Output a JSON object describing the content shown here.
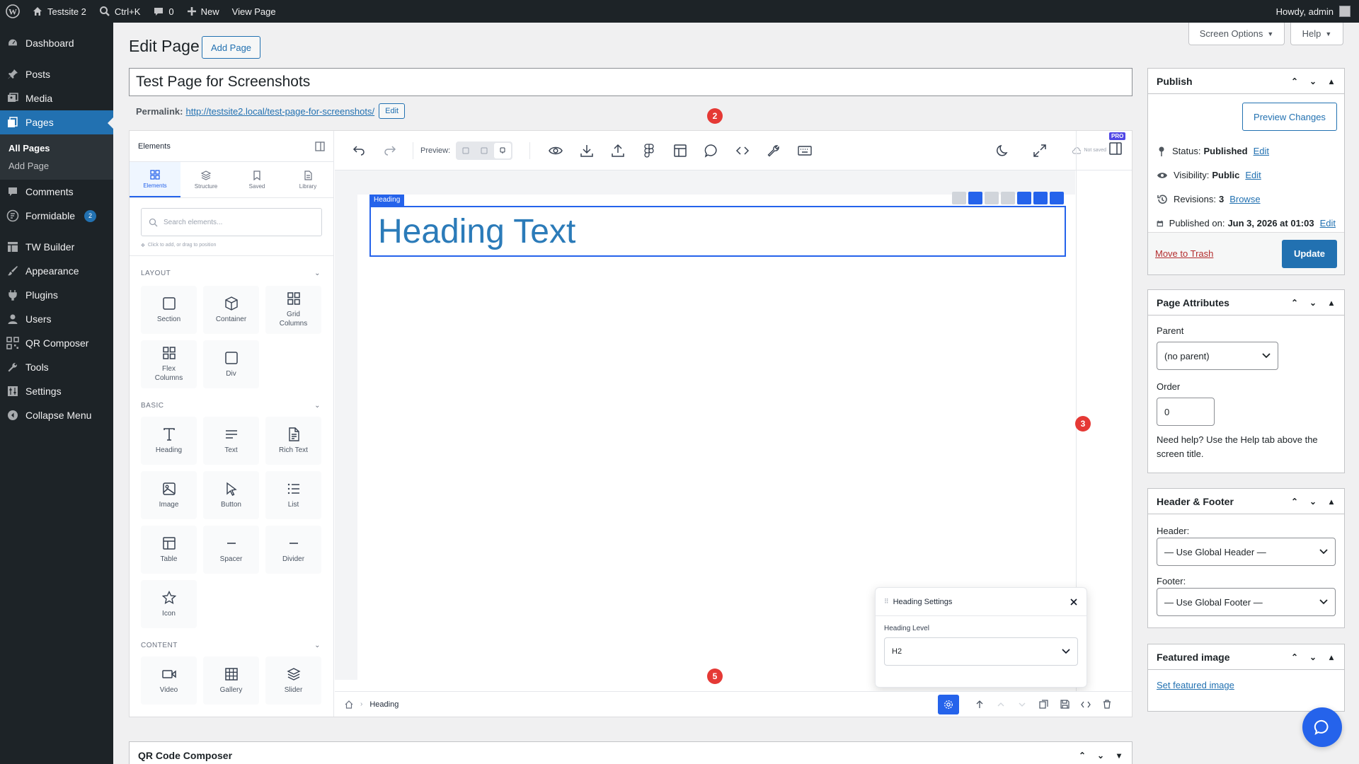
{
  "adminbar": {
    "site_name": "Testsite 2",
    "search_shortcut": "Ctrl+K",
    "comments_count": "0",
    "new_label": "New",
    "view_page": "View Page",
    "howdy": "Howdy, admin"
  },
  "sidebar": {
    "items": [
      {
        "label": "Dashboard",
        "icon": "dashboard-icon"
      },
      {
        "label": "Posts",
        "icon": "pin-icon"
      },
      {
        "label": "Media",
        "icon": "media-icon"
      },
      {
        "label": "Pages",
        "icon": "pages-icon"
      },
      {
        "label": "Comments",
        "icon": "comment-icon"
      },
      {
        "label": "Formidable",
        "icon": "formidable-icon",
        "badge": "2"
      },
      {
        "label": "TW Builder",
        "icon": "builder-icon"
      },
      {
        "label": "Appearance",
        "icon": "brush-icon"
      },
      {
        "label": "Plugins",
        "icon": "plug-icon"
      },
      {
        "label": "Users",
        "icon": "user-icon"
      },
      {
        "label": "QR Composer",
        "icon": "qr-icon"
      },
      {
        "label": "Tools",
        "icon": "wrench-icon"
      },
      {
        "label": "Settings",
        "icon": "settings-icon"
      },
      {
        "label": "Collapse Menu",
        "icon": "collapse-icon"
      }
    ],
    "submenu": [
      "All Pages",
      "Add Page"
    ]
  },
  "header": {
    "title": "Edit Page",
    "add_page": "Add Page",
    "screen_options": "Screen Options",
    "help": "Help"
  },
  "post": {
    "title": "Test Page for Screenshots",
    "permalink_label": "Permalink:",
    "permalink_url": "http://testsite2.local/test-page-for-screenshots/",
    "permalink_edit": "Edit"
  },
  "builder": {
    "panel_title": "Elements",
    "tabs": [
      "Elements",
      "Structure",
      "Saved",
      "Library"
    ],
    "search_placeholder": "Search elements...",
    "hint": "Click to add, or drag to position",
    "categories": {
      "layout": "LAYOUT",
      "basic": "BASIC",
      "content": "CONTENT"
    },
    "layout_items": [
      "Section",
      "Container",
      "Grid Columns",
      "Flex Columns",
      "Div"
    ],
    "basic_items": [
      "Heading",
      "Text",
      "Rich Text",
      "Image",
      "Button",
      "List",
      "Table",
      "Spacer",
      "Divider",
      "Icon"
    ],
    "content_items": [
      "Video",
      "Gallery",
      "Slider"
    ],
    "preview_label": "Preview:",
    "not_saved": "Not saved",
    "pro_badge": "PRO",
    "heading_tag": "Heading",
    "heading_text": "Heading Text",
    "breadcrumb": "Heading",
    "settings": {
      "title": "Heading Settings",
      "level_label": "Heading Level",
      "level_value": "H2"
    },
    "markers": [
      "2",
      "3",
      "5"
    ]
  },
  "publish": {
    "title": "Publish",
    "preview_changes": "Preview Changes",
    "status_label": "Status:",
    "status_value": "Published",
    "visibility_label": "Visibility:",
    "visibility_value": "Public",
    "revisions_label": "Revisions:",
    "revisions_value": "3",
    "browse": "Browse",
    "published_on_label": "Published on:",
    "published_on_value": "Jun 3, 2026 at 01:03",
    "edit": "Edit",
    "trash": "Move to Trash",
    "update": "Update"
  },
  "attributes": {
    "title": "Page Attributes",
    "parent_label": "Parent",
    "parent_value": "(no parent)",
    "order_label": "Order",
    "order_value": "0",
    "help": "Need help? Use the Help tab above the screen title."
  },
  "header_footer": {
    "title": "Header & Footer",
    "header_label": "Header:",
    "header_value": "— Use Global Header —",
    "footer_label": "Footer:",
    "footer_value": "— Use Global Footer —"
  },
  "featured": {
    "title": "Featured image",
    "set": "Set featured image"
  },
  "qr": {
    "title": "QR Code Composer"
  },
  "colors": {
    "wp_blue": "#2271b1",
    "builder_blue": "#2563eb",
    "heading_color": "#2b7bb9",
    "marker_red": "#e53935"
  }
}
